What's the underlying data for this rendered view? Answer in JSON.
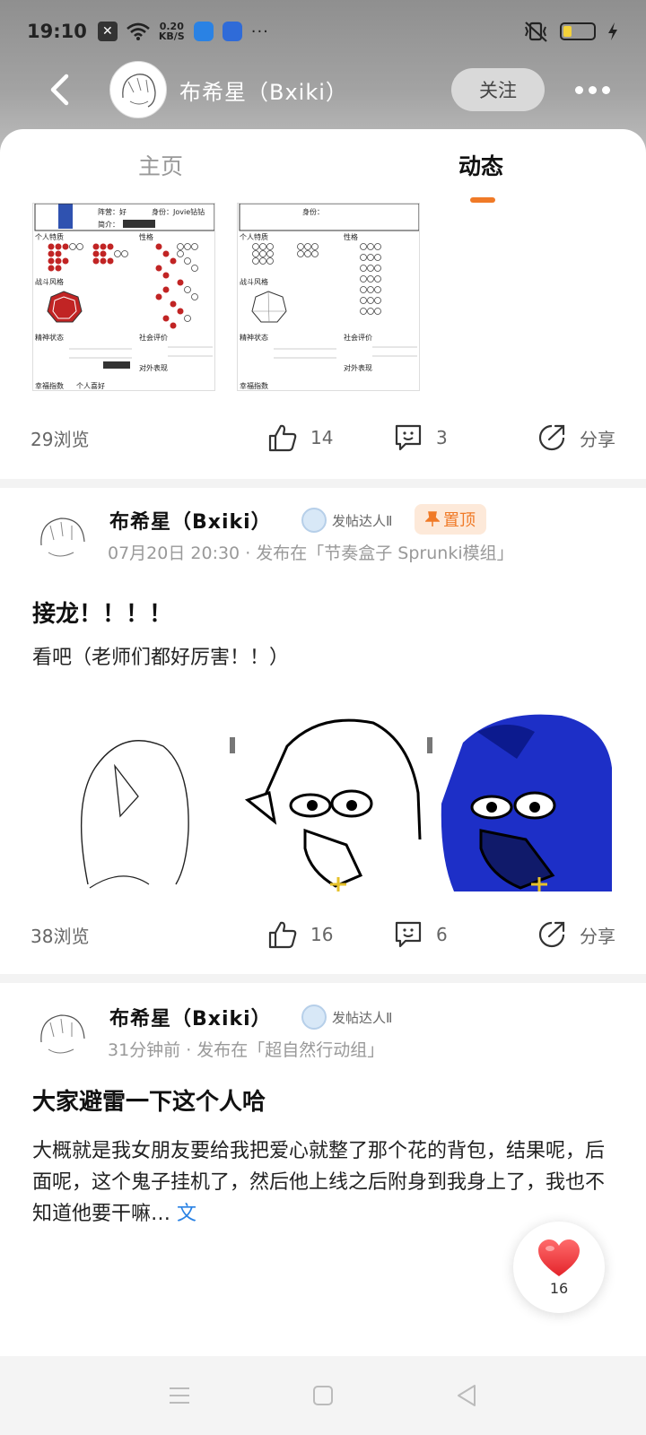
{
  "status_bar": {
    "time": "19:10",
    "net_speed_value": "0.20",
    "net_speed_unit": "KB/S",
    "more": "···"
  },
  "header": {
    "author_name": "布希星（Bxiki）",
    "follow_label": "关注"
  },
  "tabs": [
    {
      "label": "主页",
      "active": false
    },
    {
      "label": "动态",
      "active": true
    }
  ],
  "accent_color": "#f07a27",
  "posts": [
    {
      "views": "29浏览",
      "likes": "14",
      "comments": "3",
      "share_label": "分享"
    },
    {
      "author": "布希星（Bxiki）",
      "badge": "发帖达人Ⅱ",
      "pin_label": "置顶",
      "meta": "07月20日 20:30 · 发布在「节奏盒子 Sprunki模组」",
      "title": "接龙！！！！",
      "body": "看吧（老师们都好厉害！！）",
      "views": "38浏览",
      "likes": "16",
      "comments": "6",
      "share_label": "分享"
    },
    {
      "author": "布希星（Bxiki）",
      "badge": "发帖达人Ⅱ",
      "meta": "31分钟前 · 发布在「超自然行动组」",
      "title": "大家避雷一下这个人哈",
      "body": "大概就是我女朋友要给我把爱心就整了那个花的背包，结果呢，后面呢，这个鬼子挂机了，然后他上线之后附身到我身上了，我也不知道他要干嘛…",
      "more_label": "文"
    }
  ],
  "floating_like": {
    "count": "16"
  },
  "form_texts": {
    "label1": "阵营：好",
    "label2": "身份：Jovie钻钻",
    "label3": "简介：",
    "label4": "身份：",
    "label5": "个人特质",
    "label6": "性格",
    "label7": "战斗风格",
    "label8": "精神状态",
    "label9": "社会评价",
    "label10": "对外表现",
    "label11": "幸福指数",
    "label12": "个人喜好"
  }
}
